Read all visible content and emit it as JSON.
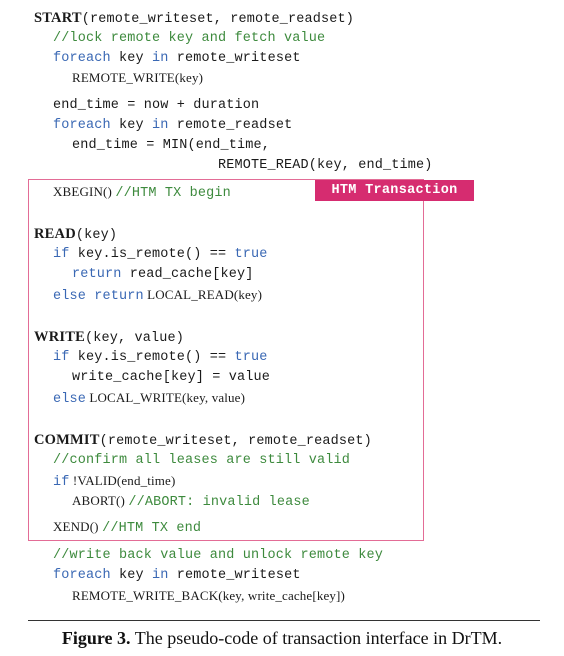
{
  "code": {
    "l1_fn": "START",
    "l1_args": "(remote_writeset, remote_readset)",
    "l2_comment": "//lock remote key and fetch value",
    "l3_foreach": "foreach",
    "l3_mid": " key ",
    "l3_in": "in",
    "l3_rest": " remote_writeset",
    "l4": "REMOTE_WRITE(key)",
    "l5": "end_time = now + duration",
    "l6_foreach": "foreach",
    "l6_mid": " key ",
    "l6_in": "in",
    "l6_rest": " remote_readset",
    "l7": "end_time = MIN(end_time,",
    "l8": "REMOTE_READ(key, end_time)",
    "l9_code": "XBEGIN() ",
    "l9_comment": "//HTM TX begin",
    "l10_fn": "READ",
    "l10_args": "(key)",
    "l11_if": "if",
    "l11_mid": " key.is_remote() == ",
    "l11_true": "true",
    "l12_return": "return",
    "l12_rest": " read_cache[key]",
    "l13_else": "else return",
    "l13_rest": " LOCAL_READ(key)",
    "l14_fn": "WRITE",
    "l14_args": "(key, value)",
    "l15_if": "if",
    "l15_mid": " key.is_remote() == ",
    "l15_true": "true",
    "l16": "write_cache[key] = value",
    "l17_else": "else",
    "l17_rest": " LOCAL_WRITE(key, value)",
    "l18_fn": "COMMIT",
    "l18_args": "(remote_writeset, remote_readset)",
    "l19_comment": "//confirm all leases are still valid",
    "l20_if": "if",
    "l20_rest": " !VALID(end_time)",
    "l21_code": "ABORT() ",
    "l21_comment": "//ABORT: invalid lease",
    "l22_code": "XEND() ",
    "l22_comment": "//HTM TX end",
    "l23_comment": "//write back value and unlock remote key",
    "l24_foreach": "foreach",
    "l24_mid": " key ",
    "l24_in": "in",
    "l24_rest": " remote_writeset",
    "l25": "REMOTE_WRITE_BACK(key, write_cache[key])"
  },
  "tag_label": "HTM Transaction",
  "caption": {
    "label": "Figure 3.",
    "text": "The pseudo-code of transaction interface in DrTM."
  },
  "colors": {
    "keyword": "#3a68b4",
    "comment": "#3d8a3d",
    "box_border": "#e36c96",
    "tag_bg": "#d62c70"
  }
}
